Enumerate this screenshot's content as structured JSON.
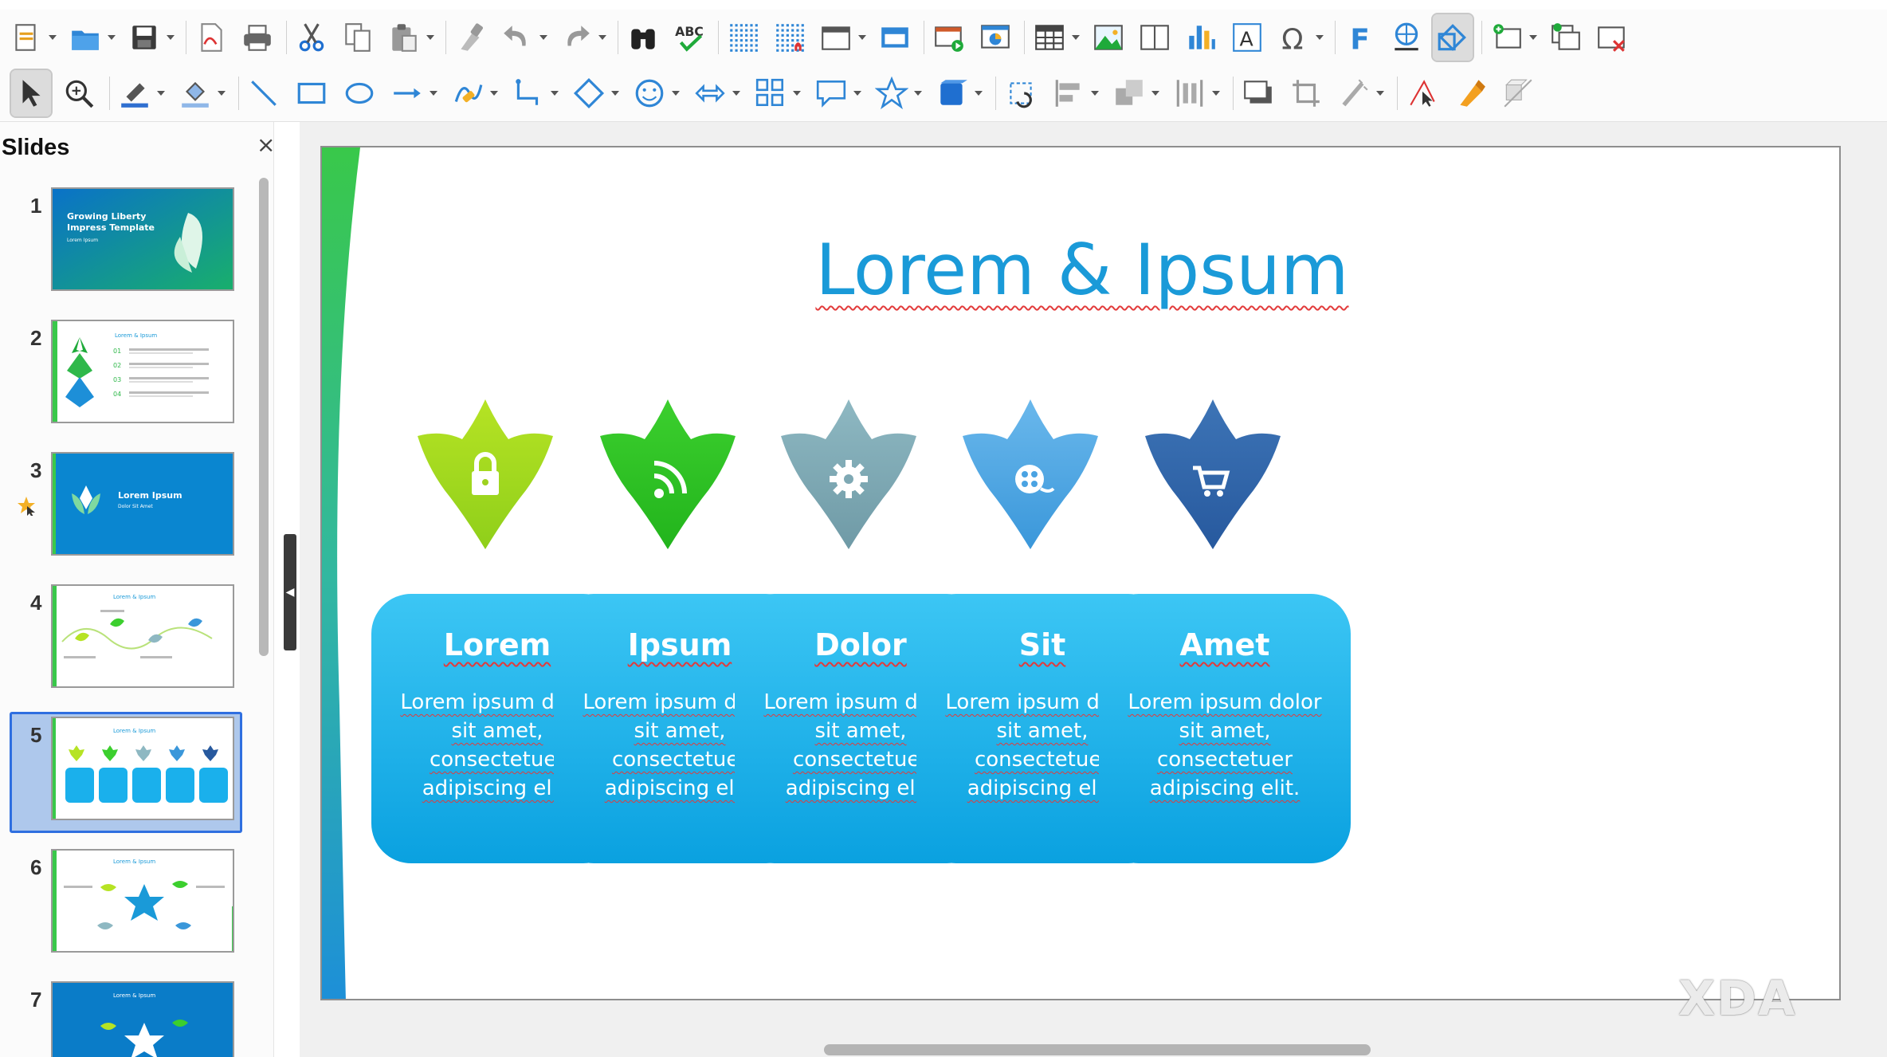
{
  "toolbar_top": {
    "tools": [
      {
        "name": "new-icon",
        "dropdown": true
      },
      {
        "name": "open-icon",
        "dropdown": true
      },
      {
        "name": "save-icon",
        "dropdown": true
      },
      {
        "name": "export-pdf-icon",
        "dropdown": false
      },
      {
        "name": "print-icon",
        "dropdown": false
      },
      {
        "name": "cut-icon",
        "dropdown": false
      },
      {
        "name": "copy-icon",
        "dropdown": false
      },
      {
        "name": "paste-icon",
        "dropdown": true
      },
      {
        "name": "clone-formatting-icon",
        "dropdown": false
      },
      {
        "name": "undo-icon",
        "dropdown": true
      },
      {
        "name": "redo-icon",
        "dropdown": true
      },
      {
        "name": "find-replace-icon",
        "dropdown": false
      },
      {
        "name": "spellcheck-icon",
        "dropdown": false,
        "label": "ABC"
      },
      {
        "name": "display-grid-icon",
        "dropdown": false
      },
      {
        "name": "snap-to-grid-icon",
        "dropdown": false
      },
      {
        "name": "display-views-icon",
        "dropdown": true
      },
      {
        "name": "master-slide-icon",
        "dropdown": false
      },
      {
        "name": "start-slideshow-icon",
        "dropdown": false
      },
      {
        "name": "slideshow-current-icon",
        "dropdown": false
      },
      {
        "name": "insert-table-icon",
        "dropdown": true
      },
      {
        "name": "insert-image-icon",
        "dropdown": false
      },
      {
        "name": "insert-media-icon",
        "dropdown": false
      },
      {
        "name": "insert-chart-icon",
        "dropdown": false
      },
      {
        "name": "insert-textbox-icon",
        "dropdown": false
      },
      {
        "name": "special-character-icon",
        "dropdown": true
      },
      {
        "name": "fontwork-icon",
        "dropdown": false
      },
      {
        "name": "hyperlink-icon",
        "dropdown": false
      },
      {
        "name": "show-draw-functions-icon",
        "dropdown": false,
        "active": true
      },
      {
        "name": "new-slide-icon",
        "dropdown": true
      },
      {
        "name": "duplicate-slide-icon",
        "dropdown": false
      },
      {
        "name": "delete-slide-icon",
        "dropdown": false
      }
    ]
  },
  "toolbar_drawing": {
    "tools": [
      {
        "name": "select-icon",
        "dropdown": false,
        "active": true
      },
      {
        "name": "zoom-pan-icon",
        "dropdown": false
      },
      {
        "name": "line-color-icon",
        "dropdown": true
      },
      {
        "name": "fill-color-icon",
        "dropdown": true
      },
      {
        "name": "line-icon",
        "dropdown": false
      },
      {
        "name": "rectangle-icon",
        "dropdown": false
      },
      {
        "name": "ellipse-icon",
        "dropdown": false
      },
      {
        "name": "arrow-line-icon",
        "dropdown": true
      },
      {
        "name": "curve-icon",
        "dropdown": true
      },
      {
        "name": "connector-icon",
        "dropdown": true
      },
      {
        "name": "basic-shapes-icon",
        "dropdown": true
      },
      {
        "name": "symbol-shapes-icon",
        "dropdown": true
      },
      {
        "name": "block-arrows-icon",
        "dropdown": true
      },
      {
        "name": "flowchart-icon",
        "dropdown": true
      },
      {
        "name": "callouts-icon",
        "dropdown": true
      },
      {
        "name": "stars-icon",
        "dropdown": true
      },
      {
        "name": "3d-objects-icon",
        "dropdown": true
      },
      {
        "name": "rotate-icon",
        "dropdown": false
      },
      {
        "name": "align-icon",
        "dropdown": true
      },
      {
        "name": "arrange-icon",
        "dropdown": true
      },
      {
        "name": "distribute-icon",
        "dropdown": true
      },
      {
        "name": "shadow-icon",
        "dropdown": false
      },
      {
        "name": "crop-icon",
        "dropdown": false
      },
      {
        "name": "filter-icon",
        "dropdown": true
      },
      {
        "name": "points-icon",
        "dropdown": false
      },
      {
        "name": "glue-points-icon",
        "dropdown": false
      },
      {
        "name": "toggle-extrusion-icon",
        "dropdown": false
      }
    ]
  },
  "sidebar": {
    "title": "Slides",
    "close_glyph": "×",
    "slides": [
      {
        "number": "1",
        "thumb": "title",
        "text": "Growing Liberty Impress Template",
        "subtext": "Lorem Ipsum"
      },
      {
        "number": "2",
        "thumb": "agenda",
        "text": "Lorem & Ipsum",
        "items": [
          "01",
          "02",
          "03",
          "04"
        ]
      },
      {
        "number": "3",
        "thumb": "section",
        "text": "Lorem Ipsum",
        "subtext": "Dolor Sit Amet"
      },
      {
        "number": "4",
        "thumb": "timeline",
        "text": "Lorem & Ipsum"
      },
      {
        "number": "5",
        "thumb": "cards",
        "text": "Lorem & Ipsum",
        "selected": true
      },
      {
        "number": "6",
        "thumb": "star",
        "text": "Lorem & Ipsum"
      },
      {
        "number": "7",
        "thumb": "star-dark",
        "text": "Lorem & Ipsum"
      }
    ]
  },
  "slide": {
    "title": "Lorem & Ipsum",
    "items": [
      {
        "title": "Lorem",
        "body": "Lorem ipsum dolor sit amet, consectetuer adipiscing elit.",
        "color_top": "#b6e324",
        "color_bottom": "#8fcf1a",
        "icon": "lock-icon"
      },
      {
        "title": "Ipsum",
        "body": "Lorem ipsum dolor sit amet, consectetuer adipiscing elit.",
        "color_top": "#3ccf2e",
        "color_bottom": "#22b41c",
        "icon": "rss-icon"
      },
      {
        "title": "Dolor",
        "body": "Lorem ipsum dolor sit amet, consectetuer adipiscing elit.",
        "color_top": "#8eb8c2",
        "color_bottom": "#6f9aa6",
        "icon": "gear-icon"
      },
      {
        "title": "Sit",
        "body": "Lorem ipsum dolor sit amet, consectetuer adipiscing elit.",
        "color_top": "#6ab8ec",
        "color_bottom": "#3a97da",
        "icon": "film-reel-icon"
      },
      {
        "title": "Amet",
        "body": "Lorem ipsum dolor sit amet, consectetuer adipiscing elit.",
        "color_top": "#3d74b6",
        "color_bottom": "#27599e",
        "icon": "cart-icon"
      }
    ]
  },
  "watermark": "XDA",
  "colors": {
    "accent": "#1a9ad8",
    "card_top": "#3cc6f4",
    "card_bottom": "#0aa1e0",
    "selection": "#2f6fe0"
  }
}
